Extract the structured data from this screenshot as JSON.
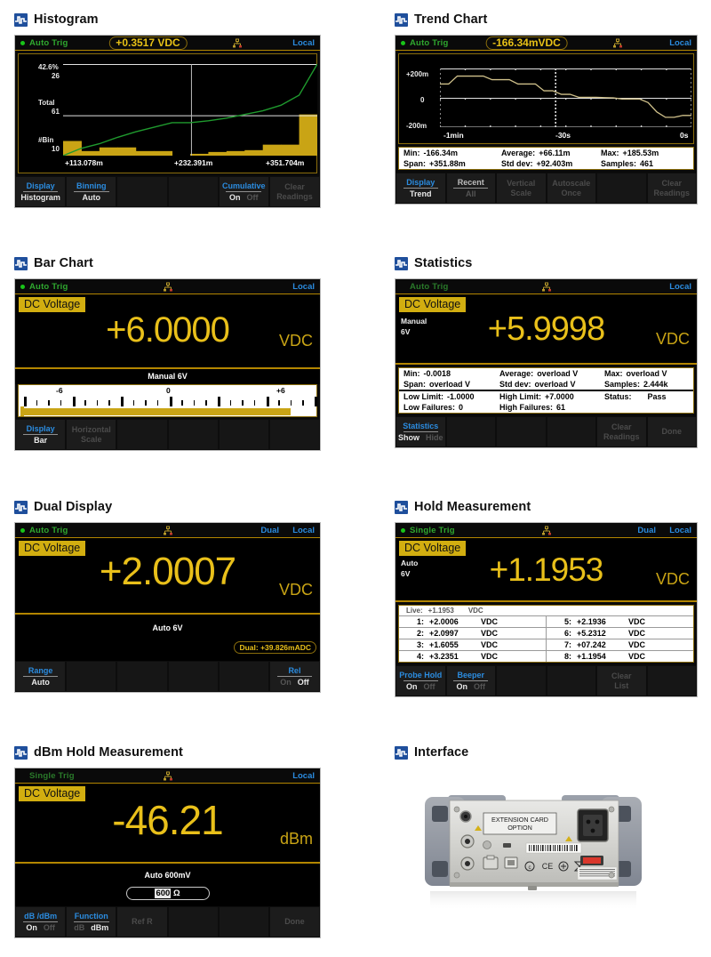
{
  "panels": {
    "histogram": {
      "title": "Histogram",
      "icon": "waveform-icon",
      "status": {
        "trig": "Auto  Trig",
        "reading": "+0.3517 VDC",
        "right": "Local"
      },
      "axis": {
        "top_pct": "42.6%",
        "top_count": "26",
        "mid_label": "Total",
        "mid_count": "61",
        "bin_label": "#Bin",
        "bin_count": "10"
      },
      "xticks": [
        "+113.078m",
        "+232.391m",
        "+351.704m"
      ],
      "softkeys": [
        {
          "top": "Display",
          "bottom": "Histogram",
          "state": "active"
        },
        {
          "top": "Binning",
          "bottom": "Auto",
          "state": "active"
        },
        {
          "top": "",
          "bottom": "",
          "state": "blank"
        },
        {
          "top": "",
          "bottom": "",
          "state": "blank"
        },
        {
          "top": "Cumulative",
          "bottom_on": "On",
          "bottom_off": "Off",
          "state": "toggle"
        },
        {
          "top": "Clear",
          "bottom": "Readings",
          "state": "disabled"
        }
      ]
    },
    "trend": {
      "title": "Trend Chart",
      "icon": "waveform-icon",
      "status": {
        "trig": "Auto  Trig",
        "reading": "-166.34mVDC",
        "right": "Local"
      },
      "yticks": [
        "+200m",
        "0",
        "-200m"
      ],
      "xticks": [
        "-1min",
        "-30s",
        "0s"
      ],
      "stats": [
        {
          "k": "Min:",
          "v": "-166.34m"
        },
        {
          "k": "Average:",
          "v": "+66.11m"
        },
        {
          "k": "Max:",
          "v": "+185.53m"
        },
        {
          "k": "Span:",
          "v": "+351.88m"
        },
        {
          "k": "Std dev:",
          "v": "+92.403m"
        },
        {
          "k": "Samples:",
          "v": "461"
        }
      ],
      "softkeys": [
        {
          "top": "Display",
          "bottom": "Trend",
          "state": "active"
        },
        {
          "top": "Recent",
          "bottom": "All",
          "state": "dim"
        },
        {
          "top": "Vertical",
          "bottom": "Scale",
          "state": "disabled"
        },
        {
          "top": "Autoscale",
          "bottom": "Once",
          "state": "disabled"
        },
        {
          "top": "",
          "bottom": "",
          "state": "blank"
        },
        {
          "top": "Clear",
          "bottom": "Readings",
          "state": "disabled"
        }
      ]
    },
    "bar": {
      "title": "Bar Chart",
      "icon": "waveform-icon",
      "status": {
        "trig": "Auto  Trig",
        "reading": "",
        "right": "Local"
      },
      "mode": "DC Voltage",
      "value": "+6.0000",
      "unit": "VDC",
      "range": "Manual 6V",
      "scale_labels": [
        "-6",
        "0",
        "+6"
      ],
      "softkeys": [
        {
          "top": "Display",
          "bottom": "Bar",
          "state": "active"
        },
        {
          "top": "Horizontal",
          "bottom": "Scale",
          "state": "disabled"
        },
        {
          "top": "",
          "bottom": "",
          "state": "blank"
        },
        {
          "top": "",
          "bottom": "",
          "state": "blank"
        },
        {
          "top": "",
          "bottom": "",
          "state": "blank"
        },
        {
          "top": "",
          "bottom": "",
          "state": "blank"
        }
      ]
    },
    "statistics": {
      "title": "Statistics",
      "icon": "waveform-icon",
      "status": {
        "trig": "Auto  Trig",
        "reading": "",
        "right": "Local"
      },
      "mode": "DC Voltage",
      "range_line1": "Manual",
      "range_line2": "6V",
      "value": "+5.9998",
      "unit": "VDC",
      "stats": [
        {
          "k": "Min:",
          "v": "-0.0018"
        },
        {
          "k": "Average:",
          "v": "overload V"
        },
        {
          "k": "Max:",
          "v": "overload V"
        },
        {
          "k": "Span:",
          "v": "overload V"
        },
        {
          "k": "Std dev:",
          "v": "overload V"
        },
        {
          "k": "Samples:",
          "v": "2.444k"
        }
      ],
      "limits": [
        {
          "k": "Low Limit:",
          "v": "-1.0000"
        },
        {
          "k": "High Limit:",
          "v": "+7.0000"
        },
        {
          "k": "Status:",
          "v": "Pass"
        },
        {
          "k": "Low Failures:",
          "v": "0"
        },
        {
          "k": "High Failures:",
          "v": "61"
        }
      ],
      "softkeys": [
        {
          "top": "Statistics",
          "bottom_on": "Show",
          "bottom_off": "Hide",
          "state": "toggle"
        },
        {
          "top": "",
          "bottom": "",
          "state": "blank"
        },
        {
          "top": "",
          "bottom": "",
          "state": "blank"
        },
        {
          "top": "",
          "bottom": "",
          "state": "blank"
        },
        {
          "top": "Clear",
          "bottom": "Readings",
          "state": "disabled"
        },
        {
          "top": "Done",
          "bottom": "",
          "state": "disabled-single"
        }
      ]
    },
    "dual": {
      "title": "Dual Display",
      "icon": "waveform-icon",
      "status": {
        "trig": "Auto  Trig",
        "dual": "Dual",
        "right": "Local"
      },
      "mode": "DC Voltage",
      "value": "+2.0007",
      "unit": "VDC",
      "range": "Auto 6V",
      "dual_reading": "Dual:  +39.826mADC",
      "softkeys": [
        {
          "top": "Range",
          "bottom": "Auto",
          "state": "active"
        },
        {
          "top": "",
          "bottom": "",
          "state": "blank"
        },
        {
          "top": "",
          "bottom": "",
          "state": "blank"
        },
        {
          "top": "",
          "bottom": "",
          "state": "blank"
        },
        {
          "top": "",
          "bottom": "",
          "state": "blank"
        },
        {
          "top": "Rel",
          "bottom_on": "On",
          "bottom_off": "Off",
          "state": "toggle-off"
        }
      ]
    },
    "hold": {
      "title": "Hold Measurement",
      "icon": "waveform-icon",
      "status": {
        "trig": "Single  Trig",
        "dual": "Dual",
        "right": "Local"
      },
      "mode": "DC Voltage",
      "range_line1": "Auto",
      "range_line2": "6V",
      "value": "+1.1953",
      "unit": "VDC",
      "live": {
        "label": "Live:",
        "value": "+1.1953",
        "unit": "VDC"
      },
      "list_left": [
        {
          "idx": "1:",
          "val": "+2.0006",
          "unit": "VDC"
        },
        {
          "idx": "2:",
          "val": "+2.0997",
          "unit": "VDC"
        },
        {
          "idx": "3:",
          "val": "+1.6055",
          "unit": "VDC"
        },
        {
          "idx": "4:",
          "val": "+3.2351",
          "unit": "VDC"
        }
      ],
      "list_right": [
        {
          "idx": "5:",
          "val": "+2.1936",
          "unit": "VDC"
        },
        {
          "idx": "6:",
          "val": "+5.2312",
          "unit": "VDC"
        },
        {
          "idx": "7:",
          "val": "+07.242",
          "unit": "VDC"
        },
        {
          "idx": "8:",
          "val": "+1.1954",
          "unit": "VDC"
        }
      ],
      "softkeys": [
        {
          "top": "Probe Hold",
          "bottom_on": "On",
          "bottom_off": "Off",
          "state": "toggle"
        },
        {
          "top": "Beeper",
          "bottom_on": "On",
          "bottom_off": "Off",
          "state": "toggle"
        },
        {
          "top": "",
          "bottom": "",
          "state": "blank"
        },
        {
          "top": "",
          "bottom": "",
          "state": "blank"
        },
        {
          "top": "Clear",
          "bottom": "List",
          "state": "disabled"
        },
        {
          "top": "",
          "bottom": "",
          "state": "blank"
        }
      ]
    },
    "dbm": {
      "title": "dBm Hold Measurement",
      "icon": "waveform-icon",
      "status": {
        "trig": "Single  Trig",
        "right": "Local"
      },
      "mode": "DC Voltage",
      "value": "-46.21",
      "unit": "dBm",
      "range": "Auto  600mV",
      "ohm_value": "600",
      "ohm_unit": "Ω",
      "softkeys": [
        {
          "top": "dB /dBm",
          "bottom_on": "On",
          "bottom_off": "Off",
          "state": "toggle"
        },
        {
          "top": "Function",
          "bottom_on": "dB",
          "bottom_off": "dBm",
          "state": "toggle-right"
        },
        {
          "top": "Ref R",
          "bottom": "",
          "state": "disabled-single"
        },
        {
          "top": "",
          "bottom": "",
          "state": "blank"
        },
        {
          "top": "",
          "bottom": "",
          "state": "blank"
        },
        {
          "top": "Done",
          "bottom": "",
          "state": "disabled-single"
        }
      ]
    },
    "interface": {
      "title": "Interface",
      "icon": "waveform-icon",
      "photo_label_line1": "EXTENSION CARD",
      "photo_label_line2": "OPTION"
    }
  },
  "colors": {
    "accent_yellow": "#c9a415",
    "reading_yellow": "#e9c01a",
    "softkey_blue": "#2b8ce0",
    "trig_green": "#2fa82f",
    "header_blue": "#1f4f9c",
    "trace_green": "#1f9a2e",
    "screen_black": "#000000"
  },
  "chart_data": [
    {
      "type": "bar",
      "title": "Histogram",
      "xlabel": "",
      "ylabel": "#Bin",
      "xticks": [
        "+113.078m",
        "+232.391m",
        "+351.704m"
      ],
      "ytop_label": "42.6%",
      "ytop_count": 26,
      "total_label": "Total",
      "total_count": 61,
      "bin_label": "#Bin",
      "bin_count": 10,
      "bin_heights": [
        16,
        5,
        9,
        9,
        5,
        5,
        0,
        2,
        4,
        5,
        6,
        12,
        12,
        45
      ],
      "cumulative_curve": [
        0,
        8,
        13,
        20,
        26,
        31,
        36,
        36,
        38,
        41,
        45,
        49,
        55,
        66,
        100
      ],
      "cumulative_on": true
    },
    {
      "type": "line",
      "title": "Trend Chart",
      "xlabel": "",
      "ylabel": "",
      "yticks": [
        "+200m",
        "0",
        "-200m"
      ],
      "ylim": [
        -0.25,
        0.25
      ],
      "xticks": [
        "-1min",
        "-30s",
        "0s"
      ],
      "series": [
        {
          "name": "trend",
          "values": [
            0.118,
            0.118,
            0.185,
            0.185,
            0.185,
            0.185,
            0.155,
            0.155,
            0.155,
            0.118,
            0.118,
            0.118,
            0.06,
            0.06,
            0.03,
            0.03,
            0.005,
            0.005,
            0.005,
            0.002,
            0.0,
            -0.01,
            -0.01,
            -0.01,
            -0.04,
            -0.12,
            -0.166,
            -0.166,
            -0.15,
            -0.15
          ]
        }
      ],
      "stats": {
        "min": "-166.34m",
        "average": "+66.11m",
        "max": "+185.53m",
        "span": "+351.88m",
        "std_dev": "+92.403m",
        "samples": "461"
      }
    },
    {
      "type": "bar",
      "title": "Bar Chart Meter",
      "categories": [
        "-6",
        "0",
        "+6"
      ],
      "value": 6.0,
      "range_min": -7.2,
      "range_max": 7.2,
      "fill_percent": 91
    }
  ]
}
